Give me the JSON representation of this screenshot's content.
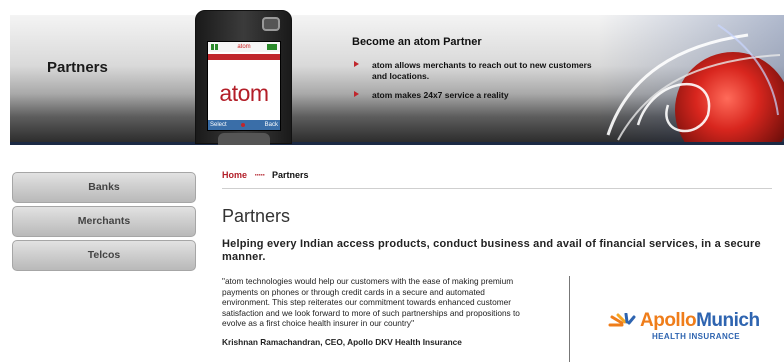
{
  "banner": {
    "title": "Partners",
    "phone": {
      "brand": "atom",
      "screen_title": "atom",
      "softkey_left": "Select",
      "softkey_right": "Back"
    },
    "promo": {
      "heading": "Become an atom Partner",
      "items": [
        "atom allows merchants to reach out to new customers and locations.",
        "atom makes 24x7 service a reality"
      ]
    }
  },
  "sidenav": {
    "items": [
      {
        "label": "Banks"
      },
      {
        "label": "Merchants"
      },
      {
        "label": "Telcos"
      }
    ]
  },
  "breadcrumb": {
    "home": "Home",
    "separator": "·····",
    "current": "Partners"
  },
  "main": {
    "title": "Partners",
    "tagline": "Helping every Indian access products, conduct business and avail of financial services, in a secure manner.",
    "quote": "\"atom technologies would help our customers with the ease of making premium payments on phones or through credit cards in a secure and automated environment. This step reiterates our commitment towards enhanced customer satisfaction and we look forward to more of such partnerships and propositions to evolve as a first choice health insurer in our country\"",
    "quote_author": "Krishnan Ramachandran, CEO, Apollo DKV Health Insurance",
    "partner_logo": {
      "name_part1": "Apollo",
      "name_part2": "Munich",
      "subtitle": "HEALTH INSURANCE"
    }
  },
  "colors": {
    "accent_red": "#b3202a",
    "nav_button": "#cfcfcf",
    "apollo_orange": "#ef7d1a",
    "apollo_blue": "#2e64b0"
  }
}
